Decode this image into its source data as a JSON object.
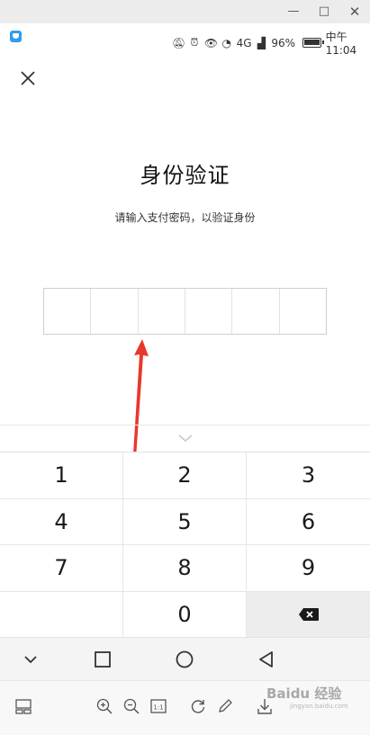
{
  "window": {
    "minimize_icon": "minimize-icon",
    "maximize_icon": "maximize-icon",
    "close_icon": "close-icon"
  },
  "status_bar": {
    "battery": "96%",
    "time": "中午11:04",
    "network": "4G"
  },
  "page": {
    "title": "身份验证",
    "subtitle": "请输入支付密码，以验证身份",
    "pin_length": 6
  },
  "keypad": {
    "keys": [
      "1",
      "2",
      "3",
      "4",
      "5",
      "6",
      "7",
      "8",
      "9",
      "",
      "0",
      "⌫"
    ]
  },
  "watermark": {
    "text": "Baidu 经验",
    "sub": "jingyan.baidu.com"
  },
  "colors": {
    "arrow": "#e8382b",
    "accent": "#2e9df0",
    "delete_key_bg": "#ededed"
  }
}
